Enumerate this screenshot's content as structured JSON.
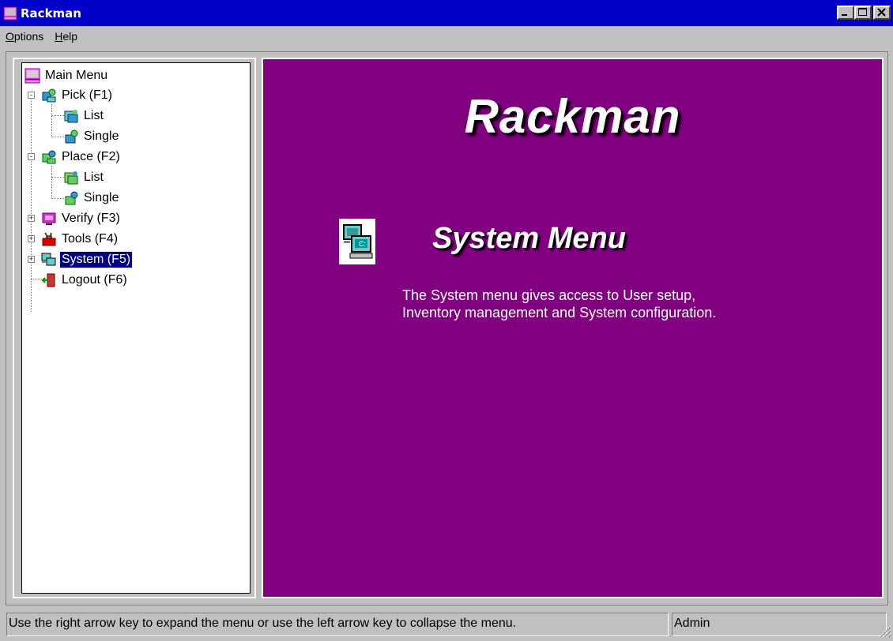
{
  "window": {
    "title": "Rackman",
    "colors": {
      "titlebar": "#0000c8",
      "content_bg": "#800080",
      "selected": "#000080"
    }
  },
  "menubar": {
    "items": [
      {
        "label": "Options",
        "underline": "O",
        "rest": "ptions"
      },
      {
        "label": "Help",
        "underline": "H",
        "rest": "elp"
      }
    ]
  },
  "tree": {
    "root": {
      "label": "Main Menu",
      "icon": "monitor-icon"
    },
    "items": [
      {
        "label": "Pick (F1)",
        "icon": "pick-icon",
        "expander": "-"
      },
      {
        "label": "List",
        "icon": "list-icon"
      },
      {
        "label": "Single",
        "icon": "single-icon"
      },
      {
        "label": "Place (F2)",
        "icon": "place-icon",
        "expander": "-"
      },
      {
        "label": "List",
        "icon": "list-icon"
      },
      {
        "label": "Single",
        "icon": "single-icon"
      },
      {
        "label": "Verify (F3)",
        "icon": "verify-icon",
        "expander": "+"
      },
      {
        "label": "Tools (F4)",
        "icon": "tools-icon",
        "expander": "+"
      },
      {
        "label": "System (F5)",
        "icon": "system-icon",
        "expander": "+",
        "selected": true
      },
      {
        "label": "Logout (F6)",
        "icon": "logout-icon"
      }
    ]
  },
  "content": {
    "app_title": "Rackman",
    "section_icon": "system-computer-icon",
    "section_title": "System Menu",
    "description_line1": "The System menu gives access to User setup,",
    "description_line2": "Inventory management and System configuration."
  },
  "statusbar": {
    "message": "Use the right arrow key to expand the menu or use the left arrow key to collapse the menu.",
    "user": "Admin"
  }
}
